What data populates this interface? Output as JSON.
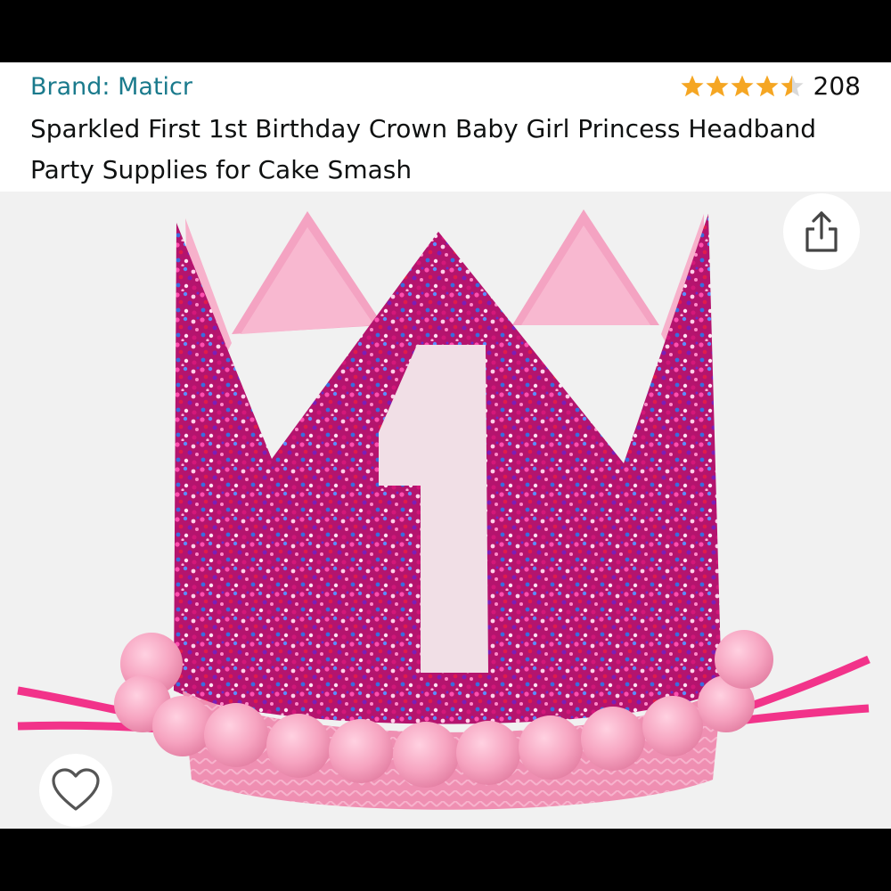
{
  "product": {
    "brand_label": "Brand: Maticr",
    "title": "Sparkled First 1st Birthday Crown Baby Girl Princess Headband Party Supplies for Cake Smash",
    "rating": 4.5,
    "rating_max": 5,
    "review_count": "208",
    "image_number": "1"
  },
  "icons": {
    "share": "share-icon",
    "favorite": "heart-outline-icon",
    "star": "star-icon"
  },
  "colors": {
    "brand_link": "#1a7a8c",
    "star": "#f5a623",
    "star_empty": "#d9d9d9",
    "glitter_base": "#b4146e",
    "felt_pink": "#f6a9c4"
  }
}
